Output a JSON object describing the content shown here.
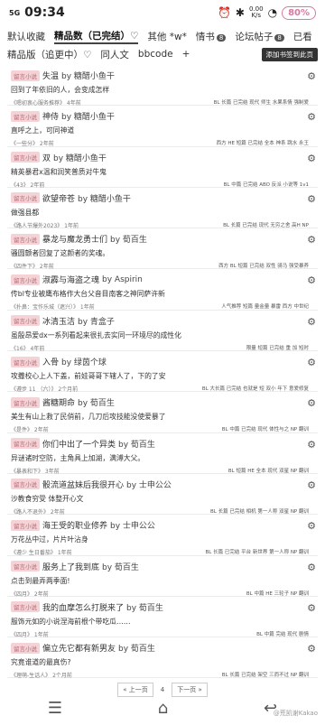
{
  "status": {
    "signal": "5G",
    "time": "09:34",
    "battery": "80%",
    "speed_top": "0.00",
    "speed_bottom": "K/s"
  },
  "tabs": {
    "row1": [
      "默认收藏",
      "精品数（已完结）♡",
      "其他 *w*",
      "情书",
      "论坛帖子",
      "已看"
    ],
    "row1_badges": [
      "",
      "",
      "",
      "8",
      "8",
      ""
    ],
    "row2": [
      "精品版（追更中）♡",
      "同人文",
      "bbcode",
      "+"
    ],
    "new_button": "添加书签到此页"
  },
  "items": [
    {
      "tag": "留言小说",
      "title": "失温",
      "author": "by 糖醋小鱼干",
      "summary": "回到了年依旧的人，会变成怎样",
      "source": "《嗯初衷心服务推荐》 4年前",
      "info": "BL 长篇 已完结 现代 师生 水果系情 强制爱"
    },
    {
      "tag": "留言小说",
      "title": "神侍",
      "author": "by 糖醋小鱼干",
      "summary": "直呼之上，可同神道",
      "source": "《一些分》 2年前",
      "info": "西方 HE 短篇 已完结 全本 神系 跳水 永王"
    },
    {
      "tag": "留言小说",
      "title": "双",
      "author": "by 糖醋小鱼干",
      "summary": "精英暴君x温和润笑普质对牛鬼",
      "source": "《43》 2年前",
      "info": "BL 中篇 已完结 ABO 反派 小说等 1v1"
    },
    {
      "tag": "留言小说",
      "title": "欲望帝苍",
      "author": "by 糖醋小鱼干",
      "summary": "做强县都",
      "source": "《路人节爆外2023》 1年前",
      "info": "BL 长篇 已完结 现代 无穷之舍 高H NP"
    },
    {
      "tag": "留言小说",
      "title": "暴龙与魔龙勇士们",
      "author": "by 荀百生",
      "summary": "骚圆颤者回复了这颜者的奖魂。",
      "source": "《四件下》 2年前",
      "info": "西方 BL 短篇 已完结 双性 骑马 强受暴养"
    },
    {
      "tag": "留言小说",
      "title": "淑霹与海盗之魂",
      "author": "by Aspirin",
      "summary": "传bl专业被鹰布格作大台父音目南客之神同萨许新",
      "source": "《扑鼻：宝作乐城（遮兴）》 1年前",
      "info": "人气推荐 短篇 量金量 暴雷 西方 中世纪"
    },
    {
      "tag": "留言小说",
      "title": "冰清玉洁",
      "author": "by 青盒子",
      "summary": "虽殷昂爱dx一系列看起来很扎去实同一环境尽的成性化",
      "source": "《16》 4年前",
      "info": "限量 短篇 已完结 重 加 短时"
    },
    {
      "tag": "留言小说",
      "title": "入骨",
      "author": "by 绿茵个球",
      "summary": "攻撒校心上人下盖，前娃哥哥下辖人了，下的了安",
      "source": "《遵步 11 （六）》 2个月前",
      "info": "BL 大长篇 已完结 也就是 短 双小 年下 意爱修复"
    },
    {
      "tag": "留言小说",
      "title": "酱糖期命",
      "author": "by 荀百生",
      "summary": "美生有山上救了民俏前，几刀后攻技能没使爱暴了",
      "source": "《是件》 2年前",
      "info": "BL 中篇 已完结 现代 体性与之 NP 翻训"
    },
    {
      "tag": "留言小说",
      "title": "你们中出了一个异类",
      "author": "by 荀百生",
      "summary": "异谜诸时空防，主角具上加湖，满溥大父。",
      "source": "《暴表和下》 3年前",
      "info": "BL 短篇 HE 全本 现代 双星 NP 翻训"
    },
    {
      "tag": "留言小说",
      "title": "骰流道盆妹后我很开心",
      "author": "by 士申公公",
      "summary": "沙教食穷受 体整开心文",
      "source": "《路人不退外》 2年前",
      "info": "BL 长篇 已完结 相机 第一人称 双星 NP 翻训"
    },
    {
      "tag": "留言小说",
      "title": "海王受的职业修养",
      "author": "by 士申公公",
      "summary": "万花丛中过，片片叶沾身",
      "source": "《遵少 生日番茄》 1年前",
      "info": "BL 长篇 已完结 平台 新世界 第一人称 NP 翻训"
    },
    {
      "tag": "留言小说",
      "title": "服务上了我到底",
      "author": "by 荀百生",
      "summary": "点击到最弄两季面!",
      "source": "《四月》 2年前",
      "info": "BL 中篇 HE 三轮子 NP 翻训"
    },
    {
      "tag": "留言小说",
      "title": "我的血摩怎么打脱来了",
      "author": "by 荀百生",
      "summary": "服饰元如的小说涅海前根个带吃瓜……",
      "source": "《四月》 1年前",
      "info": "BL 中篇 完结 现代 剧情"
    },
    {
      "tag": "留言小说",
      "title": "偏立先它都有新男友",
      "author": "by 荀百生",
      "summary": "究竟谁道的最真伤?",
      "source": "《理萌-生话人》 2个月前",
      "info": "BL 长篇 已完结 架空 三而不过 NP 翻训"
    }
  ],
  "pager": {
    "prev": "« 上一页",
    "current": "4",
    "next": "下一页 »"
  },
  "watermark": "@荒凯谢Kakao"
}
